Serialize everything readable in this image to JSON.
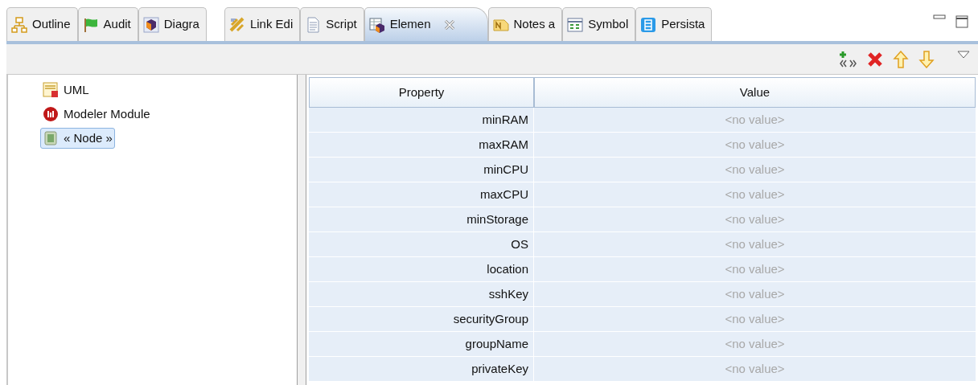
{
  "tabs": [
    {
      "label": "Outline",
      "kind": "hierarchy",
      "selected": false
    },
    {
      "label": "Audit",
      "kind": "flag",
      "selected": false
    },
    {
      "label": "Diagra",
      "kind": "cube",
      "selected": false
    },
    {
      "label": "Link Edi",
      "kind": "link",
      "selected": false
    },
    {
      "label": "Script",
      "kind": "page",
      "selected": false
    },
    {
      "label": "Elemen",
      "kind": "table",
      "selected": true
    },
    {
      "label": "Notes a",
      "kind": "note",
      "selected": false
    },
    {
      "label": "Symbol",
      "kind": "symbols",
      "selected": false
    },
    {
      "label": "Persista",
      "kind": "list",
      "selected": false
    }
  ],
  "tree": [
    {
      "label": "UML",
      "kind": "uml",
      "selected": false
    },
    {
      "label": "Modeler Module",
      "kind": "module",
      "selected": false
    },
    {
      "label": "« Node »",
      "kind": "node",
      "selected": true
    }
  ],
  "table": {
    "columns": [
      "Property",
      "Value"
    ],
    "rows": [
      {
        "property": "minRAM",
        "value": "<no value>",
        "disabled": true
      },
      {
        "property": "maxRAM",
        "value": "<no value>",
        "disabled": true
      },
      {
        "property": "minCPU",
        "value": "<no value>",
        "disabled": true
      },
      {
        "property": "maxCPU",
        "value": "<no value>",
        "disabled": true
      },
      {
        "property": "minStorage",
        "value": "<no value>",
        "disabled": true
      },
      {
        "property": "OS",
        "value": "<no value>",
        "disabled": true
      },
      {
        "property": "location",
        "value": "<no value>",
        "disabled": true
      },
      {
        "property": "sshKey",
        "value": "<no value>",
        "disabled": true
      },
      {
        "property": "securityGroup",
        "value": "<no value>",
        "disabled": true
      },
      {
        "property": "groupName",
        "value": "<no value>",
        "disabled": true
      },
      {
        "property": "privateKey",
        "value": "<no value>",
        "disabled": true
      }
    ]
  }
}
